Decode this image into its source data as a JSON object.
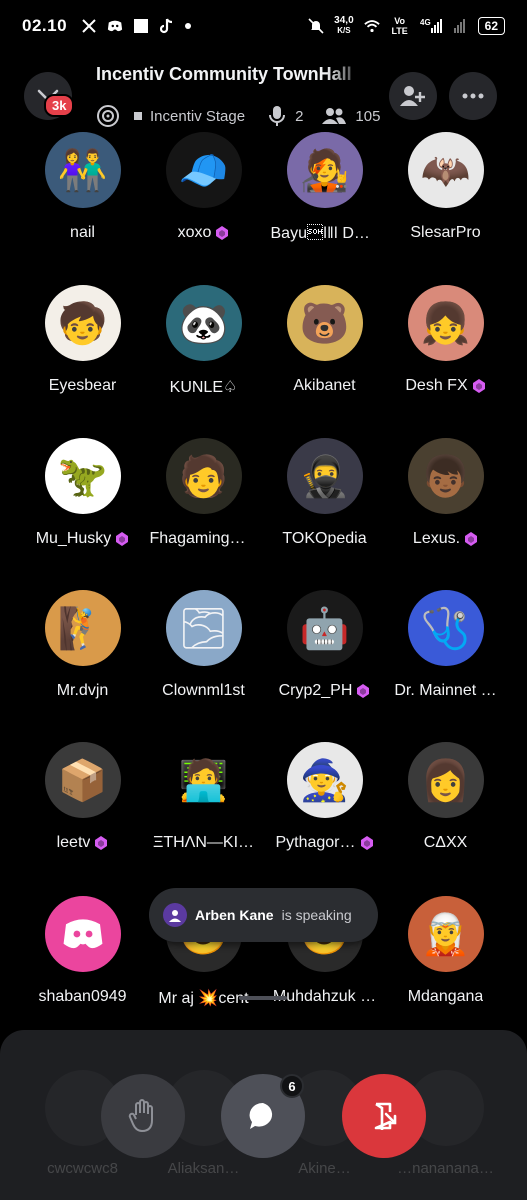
{
  "status_bar": {
    "time": "02.10",
    "net_speed_value": "34,0",
    "net_speed_unit": "K/S",
    "volte": "Vo LTE",
    "network": "4G",
    "battery": "62"
  },
  "header": {
    "title": "Incentiv Community TownHall",
    "badge": "3k",
    "stage_name": "Incentiv Stage",
    "speaker_count": "2",
    "listener_count": "105"
  },
  "participants": [
    {
      "name": "nail",
      "nitro": false,
      "bg": "#3b5a7a",
      "emoji": "👫"
    },
    {
      "name": "xoxo",
      "nitro": true,
      "bg": "#151515",
      "emoji": "🧢"
    },
    {
      "name": "Bayu\u0001ǀǁǀ DeS…",
      "nitro": false,
      "bg": "#7a6aa8",
      "emoji": "🧑‍🎤"
    },
    {
      "name": "SlesarPro",
      "nitro": false,
      "bg": "#e8e8e8",
      "emoji": "🦇"
    },
    {
      "name": "Eyesbear",
      "nitro": false,
      "bg": "#f3efe8",
      "emoji": "🧒"
    },
    {
      "name": "KUNLE♤",
      "nitro": false,
      "bg": "#2c6a7a",
      "emoji": "🐼"
    },
    {
      "name": "Akibanet",
      "nitro": false,
      "bg": "#d8b35a",
      "emoji": "🐻"
    },
    {
      "name": "Desh FX",
      "nitro": true,
      "bg": "#d98a7a",
      "emoji": "👧"
    },
    {
      "name": "Mu_Husky",
      "nitro": true,
      "bg": "#ffffff",
      "emoji": "🦖"
    },
    {
      "name": "Fhagaming™…",
      "nitro": false,
      "bg": "#2a2a22",
      "emoji": "🧑"
    },
    {
      "name": "TOKOpedia",
      "nitro": false,
      "bg": "#3a3a48",
      "emoji": "🥷"
    },
    {
      "name": "Lexus.",
      "nitro": true,
      "bg": "#4a4030",
      "emoji": "👦🏾"
    },
    {
      "name": "Mr.dvjn",
      "nitro": false,
      "bg": "#d99a4a",
      "emoji": "🧗"
    },
    {
      "name": "Clownml1st",
      "nitro": false,
      "bg": "#8aa8c8",
      "emoji": "🌫"
    },
    {
      "name": "Cryp2_PH",
      "nitro": true,
      "bg": "#1a1a1a",
      "emoji": "🤖"
    },
    {
      "name": "Dr. Mainnet …",
      "nitro": false,
      "bg": "#3a5ad8",
      "emoji": "🩺"
    },
    {
      "name": "leetv",
      "nitro": true,
      "bg": "#3a3a3a",
      "emoji": "📦"
    },
    {
      "name": "ΞTHΛN—KI…",
      "nitro": false,
      "bg": "#000000",
      "emoji": "🧑‍💻"
    },
    {
      "name": "Pythagor…",
      "nitro": true,
      "bg": "#e8e8e8",
      "emoji": "🧙"
    },
    {
      "name": "CΔXX",
      "nitro": false,
      "bg": "#3a3a3a",
      "emoji": "👩"
    },
    {
      "name": "shaban0949",
      "nitro": false,
      "bg": "#eb459e",
      "emoji": "discord"
    },
    {
      "name": "Mr aj 💥cent",
      "nitro": false,
      "bg": "#2a2a2a",
      "emoji": "🙂"
    },
    {
      "name": "Muhdahzuk …",
      "nitro": false,
      "bg": "#2a2a2a",
      "emoji": "🙂"
    },
    {
      "name": "Mdangana",
      "nitro": false,
      "bg": "#c8603a",
      "emoji": "🧝"
    }
  ],
  "speaking_toast": {
    "name": "Arben Kane",
    "text": "is speaking"
  },
  "ghost_row": [
    "cwcwcwc8",
    "Aliaksan…",
    "Akine…",
    "…nananana…"
  ],
  "controls": {
    "raise_hand": "raise-hand",
    "chat_badge": "6",
    "leave": "leave"
  },
  "colors": {
    "nitro": "#d65cf2",
    "leave": "#da373c",
    "control_gray": "#4e5058"
  }
}
